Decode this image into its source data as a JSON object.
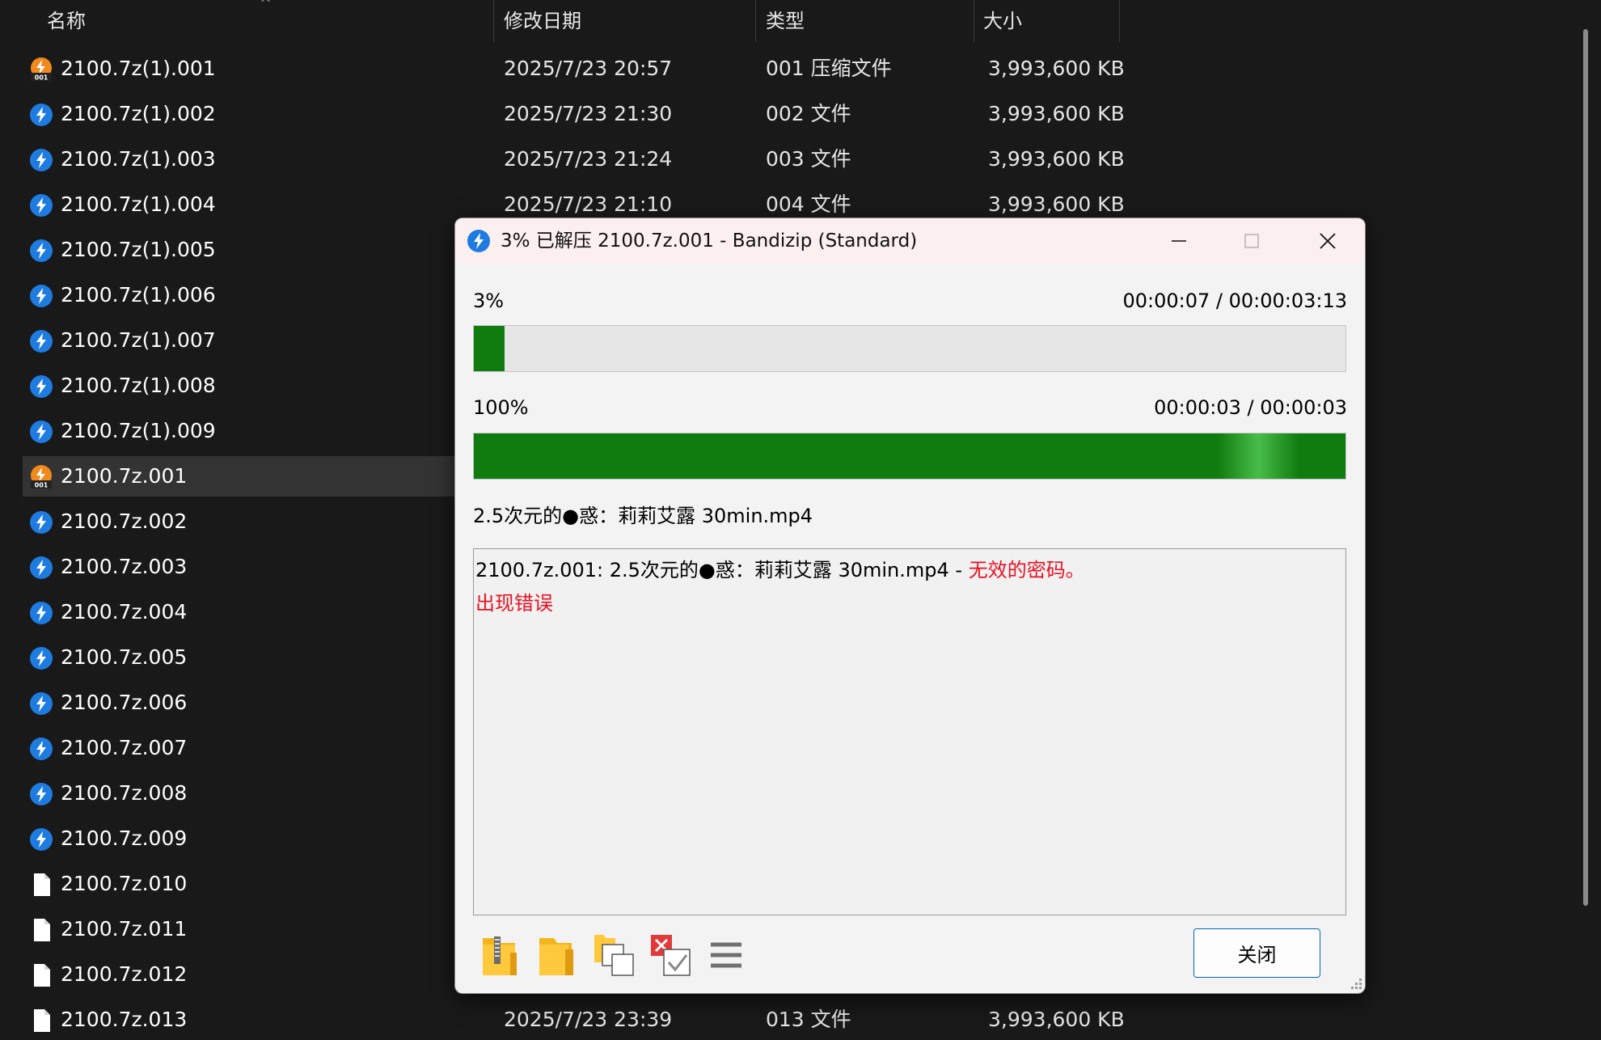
{
  "explorer": {
    "columns": {
      "name": "名称",
      "date": "修改日期",
      "type": "类型",
      "size": "大小"
    },
    "files": [
      {
        "name": "2100.7z(1).001",
        "date": "2025/7/23 20:57",
        "type": "001 压缩文件",
        "size": "3,993,600 KB",
        "icon": "bandizip-first-volume-icon"
      },
      {
        "name": "2100.7z(1).002",
        "date": "2025/7/23 21:30",
        "type": "002 文件",
        "size": "3,993,600 KB",
        "icon": "bandizip-icon"
      },
      {
        "name": "2100.7z(1).003",
        "date": "2025/7/23 21:24",
        "type": "003 文件",
        "size": "3,993,600 KB",
        "icon": "bandizip-icon"
      },
      {
        "name": "2100.7z(1).004",
        "date": "2025/7/23 21:10",
        "type": "004 文件",
        "size": "3,993,600 KB",
        "icon": "bandizip-icon"
      },
      {
        "name": "2100.7z(1).005",
        "icon": "bandizip-icon"
      },
      {
        "name": "2100.7z(1).006",
        "icon": "bandizip-icon"
      },
      {
        "name": "2100.7z(1).007",
        "icon": "bandizip-icon"
      },
      {
        "name": "2100.7z(1).008",
        "icon": "bandizip-icon"
      },
      {
        "name": "2100.7z(1).009",
        "icon": "bandizip-icon"
      },
      {
        "name": "2100.7z.001",
        "icon": "bandizip-first-volume-icon",
        "selected": true
      },
      {
        "name": "2100.7z.002",
        "icon": "bandizip-icon"
      },
      {
        "name": "2100.7z.003",
        "icon": "bandizip-icon"
      },
      {
        "name": "2100.7z.004",
        "icon": "bandizip-icon"
      },
      {
        "name": "2100.7z.005",
        "icon": "bandizip-icon"
      },
      {
        "name": "2100.7z.006",
        "icon": "bandizip-icon"
      },
      {
        "name": "2100.7z.007",
        "icon": "bandizip-icon"
      },
      {
        "name": "2100.7z.008",
        "icon": "bandizip-icon"
      },
      {
        "name": "2100.7z.009",
        "icon": "bandizip-icon"
      },
      {
        "name": "2100.7z.010",
        "icon": "blank-file-icon"
      },
      {
        "name": "2100.7z.011",
        "icon": "blank-file-icon"
      },
      {
        "name": "2100.7z.012",
        "icon": "blank-file-icon"
      },
      {
        "name": "2100.7z.013",
        "date": "2025/7/23 23:39",
        "type": "013 文件",
        "size": "3,993,600 KB",
        "icon": "blank-file-icon"
      }
    ]
  },
  "dialog": {
    "title": "3% 已解压 2100.7z.001 - Bandizip (Standard)",
    "window_buttons": [
      "minimize-icon",
      "maximize-icon",
      "close-icon"
    ],
    "total_progress": {
      "percent_label": "3%",
      "time": "00:00:07 / 00:00:03:13",
      "fraction": 0.035
    },
    "file_progress": {
      "percent_label": "100%",
      "time": "00:00:03 / 00:00:03",
      "fraction": 1.0
    },
    "current_file": "2.5次元的●惑：莉莉艾露 30min.mp4",
    "log": {
      "line1_prefix": "2100.7z.001: 2.5次元的●惑：莉莉艾露 30min.mp4 - ",
      "line1_error": "无效的密码。",
      "line2_error": "出现错误"
    },
    "toolbar_icons": [
      "open-archive-folder-icon",
      "open-folder-icon",
      "copy-files-icon",
      "verify-check-icon",
      "menu-icon"
    ],
    "close_button_label": "关闭",
    "colors": {
      "progress_green": "#107c10",
      "error_red": "#e81123",
      "button_border": "#0067c0"
    }
  }
}
